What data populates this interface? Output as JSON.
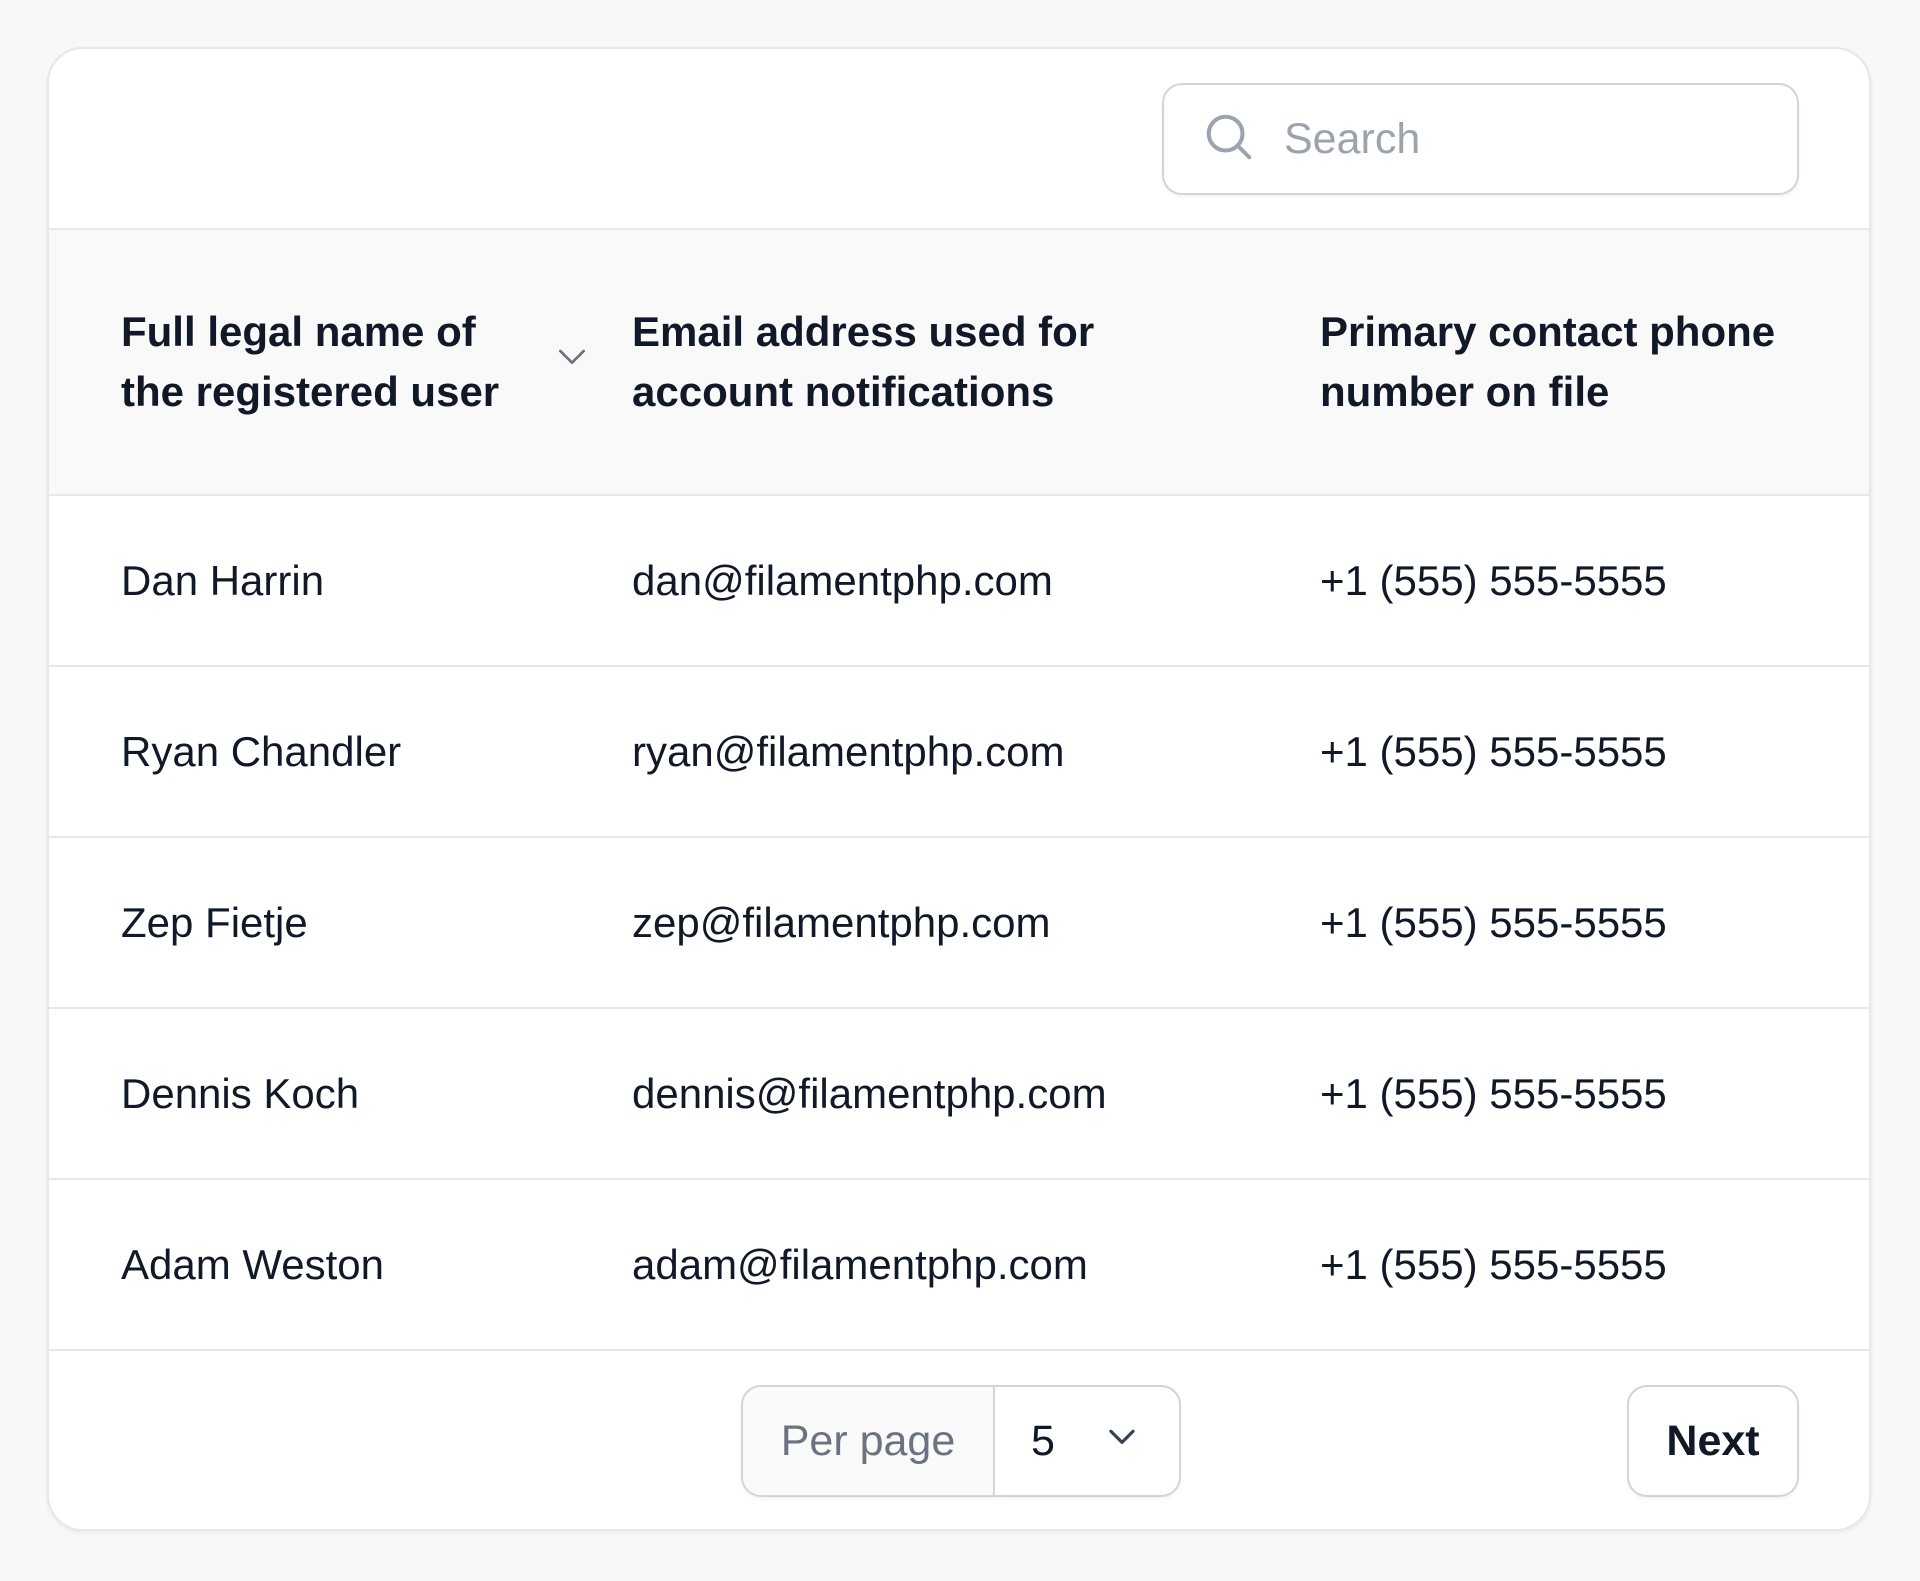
{
  "search": {
    "placeholder": "Search",
    "icon": "search-icon"
  },
  "table": {
    "columns": [
      {
        "label": "Full legal name of the registered user",
        "sortable": true,
        "sort_icon": "chevron-down-icon"
      },
      {
        "label": "Email address used for account notifications"
      },
      {
        "label": "Primary contact phone number on file"
      }
    ],
    "rows": [
      {
        "name": "Dan Harrin",
        "email": "dan@filamentphp.com",
        "phone": "+1 (555) 555-5555"
      },
      {
        "name": "Ryan Chandler",
        "email": "ryan@filamentphp.com",
        "phone": "+1 (555) 555-5555"
      },
      {
        "name": "Zep Fietje",
        "email": "zep@filamentphp.com",
        "phone": "+1 (555) 555-5555"
      },
      {
        "name": "Dennis Koch",
        "email": "dennis@filamentphp.com",
        "phone": "+1 (555) 555-5555"
      },
      {
        "name": "Adam Weston",
        "email": "adam@filamentphp.com",
        "phone": "+1 (555) 555-5555"
      }
    ]
  },
  "pagination": {
    "per_page_label": "Per page",
    "per_page_value": "5",
    "next_label": "Next"
  },
  "colors": {
    "background": "#f8f8f8",
    "card": "#ffffff",
    "header_bg": "#f9f9fa",
    "border": "#e5e7eb",
    "text": "#111827",
    "muted": "#9ca3af"
  }
}
